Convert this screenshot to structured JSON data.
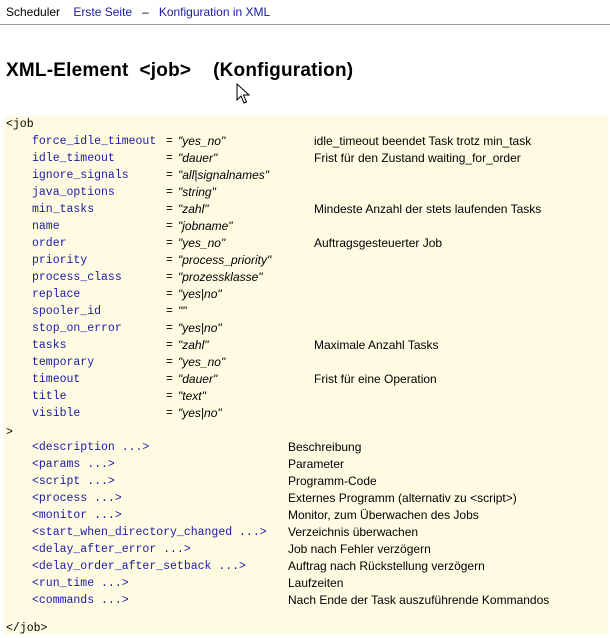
{
  "nav": {
    "home": "Scheduler",
    "first_page": "Erste Seite",
    "separator": "–",
    "xml_config": "Konfiguration in XML"
  },
  "title": "XML-Element  <job>    (Konfiguration)",
  "code": {
    "open_tag": "<job",
    "close_bracket": ">",
    "close_tag": "</job>",
    "attributes": [
      {
        "name": "force_idle_timeout",
        "eq": "=",
        "value": "\"yes_no\"",
        "desc": "idle_timeout beendet Task trotz min_task"
      },
      {
        "name": "idle_timeout",
        "eq": "=",
        "value": "\"dauer\"",
        "desc": "Frist für den Zustand waiting_for_order"
      },
      {
        "name": "ignore_signals",
        "eq": "=",
        "value": "\"all|signalnames\"",
        "desc": ""
      },
      {
        "name": "java_options",
        "eq": "=",
        "value": "\"string\"",
        "desc": ""
      },
      {
        "name": "min_tasks",
        "eq": "=",
        "value": "\"zahl\"",
        "desc": "Mindeste Anzahl der stets laufenden Tasks"
      },
      {
        "name": "name",
        "eq": "=",
        "value": "\"jobname\"",
        "desc": ""
      },
      {
        "name": "order",
        "eq": "=",
        "value": "\"yes_no\"",
        "desc": "Auftragsgesteuerter Job"
      },
      {
        "name": "priority",
        "eq": "=",
        "value": "\"process_priority\"",
        "desc": ""
      },
      {
        "name": "process_class",
        "eq": "=",
        "value": "\"prozessklasse\"",
        "desc": ""
      },
      {
        "name": "replace",
        "eq": "=",
        "value": "\"yes|no\"",
        "desc": ""
      },
      {
        "name": "spooler_id",
        "eq": "=",
        "value": "\"\"",
        "desc": ""
      },
      {
        "name": "stop_on_error",
        "eq": "=",
        "value": "\"yes|no\"",
        "desc": ""
      },
      {
        "name": "tasks",
        "eq": "=",
        "value": "\"zahl\"",
        "desc": "Maximale Anzahl Tasks"
      },
      {
        "name": "temporary",
        "eq": "=",
        "value": "\"yes_no\"",
        "desc": ""
      },
      {
        "name": "timeout",
        "eq": "=",
        "value": "\"dauer\"",
        "desc": "Frist für eine Operation"
      },
      {
        "name": "title",
        "eq": "=",
        "value": "\"text\"",
        "desc": ""
      },
      {
        "name": "visible",
        "eq": "=",
        "value": "\"yes|no\"",
        "desc": ""
      }
    ],
    "children": [
      {
        "element": "<description ...>",
        "desc": "Beschreibung"
      },
      {
        "element": "<params ...>",
        "desc": "Parameter"
      },
      {
        "element": "<script ...>",
        "desc": "Programm-Code"
      },
      {
        "element": "<process ...>",
        "desc": "Externes Programm (alternativ zu <script>)"
      },
      {
        "element": "<monitor ...>",
        "desc": "Monitor, zum Überwachen des Jobs"
      },
      {
        "element": "<start_when_directory_changed ...>",
        "desc": "Verzeichnis überwachen"
      },
      {
        "element": "<delay_after_error ...>",
        "desc": "Job nach Fehler verzögern"
      },
      {
        "element": "<delay_order_after_setback ...>",
        "desc": "Auftrag nach Rückstellung verzögern"
      },
      {
        "element": "<run_time ...>",
        "desc": "Laufzeiten"
      },
      {
        "element": "<commands ...>",
        "desc": "Nach Ende der Task auszuführende Kommandos"
      }
    ]
  }
}
